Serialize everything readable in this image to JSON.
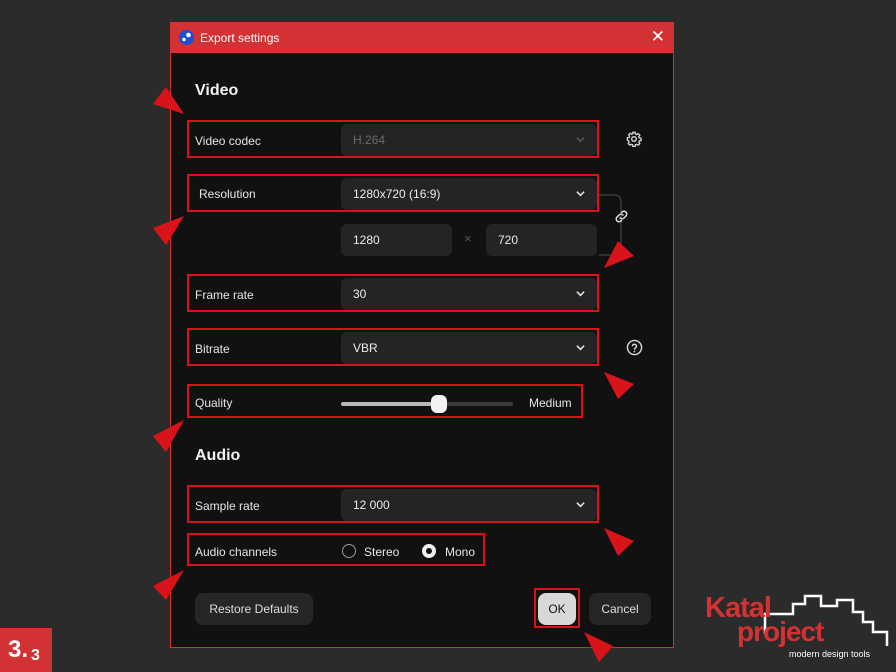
{
  "dialog": {
    "title": "Export settings"
  },
  "video": {
    "heading": "Video",
    "codec": {
      "label": "Video codec",
      "value": "H.264"
    },
    "resolution": {
      "label": "Resolution",
      "value": "1280x720 (16:9)",
      "width": "1280",
      "height": "720",
      "separator": "×"
    },
    "frame_rate": {
      "label": "Frame rate",
      "value": "30"
    },
    "bitrate": {
      "label": "Bitrate",
      "value": "VBR"
    },
    "quality": {
      "label": "Quality",
      "value_label": "Medium",
      "level_percent": 57
    }
  },
  "audio": {
    "heading": "Audio",
    "sample_rate": {
      "label": "Sample rate",
      "value": "12 000"
    },
    "channels": {
      "label": "Audio channels",
      "options": [
        "Stereo",
        "Mono"
      ],
      "selected": "Mono"
    }
  },
  "buttons": {
    "restore": "Restore Defaults",
    "ok": "OK",
    "cancel": "Cancel"
  },
  "badge": {
    "major": "3.",
    "minor": "3"
  },
  "logo": {
    "word1": "Katal",
    "word2": "project",
    "tagline": "modern design tools"
  },
  "colors": {
    "accent": "#d23233",
    "annotation": "#d8141a",
    "field": "#242424",
    "background": "#111111"
  },
  "icons": [
    "gear-icon",
    "link-icon",
    "help-icon",
    "chevron-down-icon",
    "close-icon"
  ]
}
